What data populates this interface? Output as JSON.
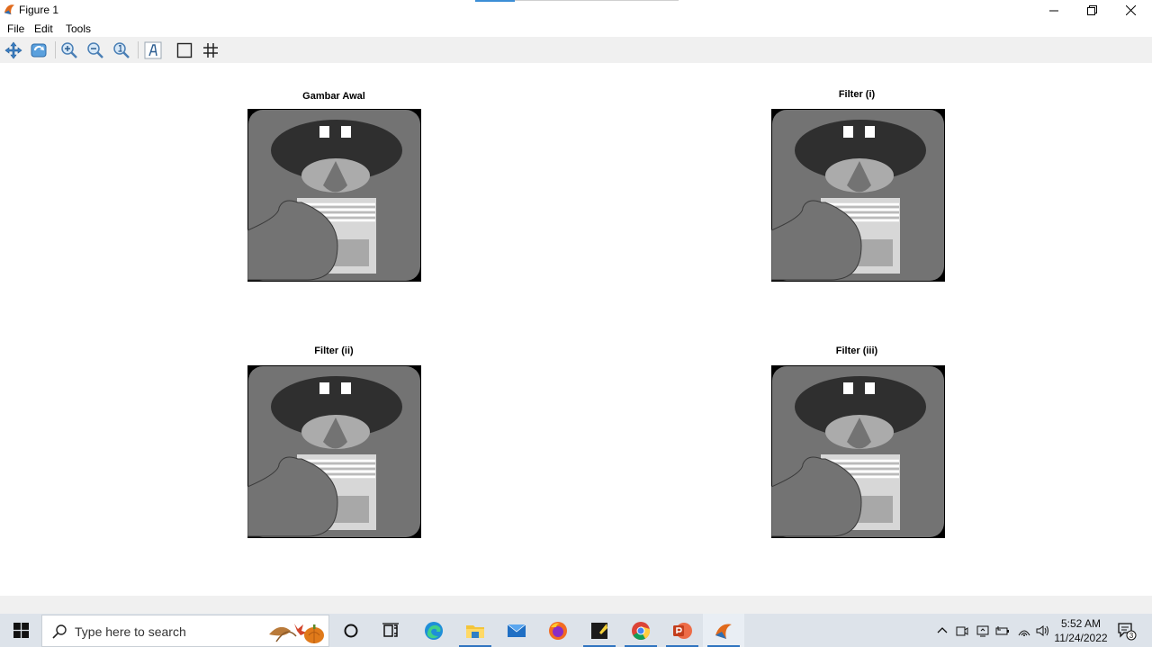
{
  "window": {
    "title": "Figure 1",
    "icon": "matlab-icon"
  },
  "menu": {
    "items": [
      "File",
      "Edit",
      "Tools"
    ]
  },
  "toolbar": {
    "buttons": [
      "pan-icon",
      "rotate-icon",
      "zoom-in-icon",
      "zoom-out-icon",
      "zoom-reset-icon",
      "text-icon",
      "box-icon",
      "grid-icon"
    ]
  },
  "figure": {
    "subplots": [
      {
        "title": "Gambar Awal"
      },
      {
        "title": "Filter (i)"
      },
      {
        "title": "Filter (ii)"
      },
      {
        "title": "Filter (iii)"
      }
    ]
  },
  "taskbar": {
    "search_placeholder": "Type here to search",
    "apps": [
      "cortana-icon",
      "task-view-icon",
      "edge-icon",
      "file-explorer-icon",
      "mail-icon",
      "firefox-icon",
      "sticky-notes-icon",
      "chrome-icon",
      "powerpoint-icon",
      "matlab-icon"
    ],
    "clock": {
      "time": "5:52 AM",
      "date": "11/24/2022"
    },
    "notifications_count": "3"
  },
  "colors": {
    "toolbar_bg": "#f0f0f0",
    "taskbar_bg": "#dde3ea",
    "accent": "#2f74c0"
  }
}
